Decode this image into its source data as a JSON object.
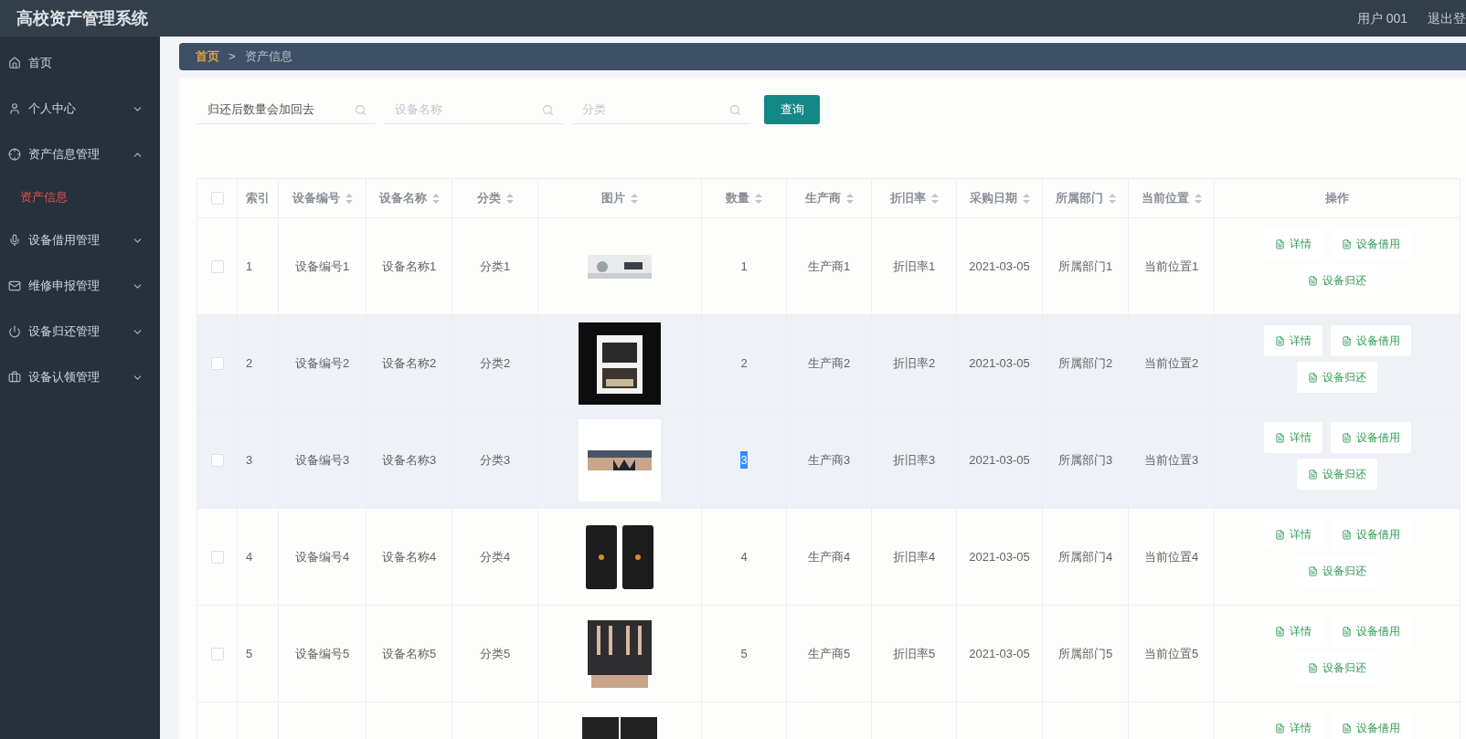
{
  "header": {
    "title": "高校资产管理系统",
    "user": "用户 001",
    "logout": "退出登"
  },
  "sidebar": {
    "items": [
      {
        "label": "首页"
      },
      {
        "label": "个人中心",
        "expanded": false
      },
      {
        "label": "资产信息管理",
        "expanded": true,
        "children": [
          {
            "label": "资产信息",
            "selected": true
          }
        ]
      },
      {
        "label": "设备借用管理",
        "expanded": false
      },
      {
        "label": "维修申报管理",
        "expanded": false
      },
      {
        "label": "设备归还管理",
        "expanded": false
      },
      {
        "label": "设备认领管理",
        "expanded": false
      }
    ]
  },
  "breadcrumb": [
    {
      "label": "首页",
      "selected": true
    },
    {
      "label": "资产信息",
      "selected": false
    }
  ],
  "separator": ">",
  "search": {
    "fields": [
      {
        "value": "归还后数量会加回去"
      },
      {
        "placeholder": "设备名称"
      },
      {
        "placeholder": "分类"
      }
    ],
    "button": "查询"
  },
  "table": {
    "all_checked": false,
    "columns": [
      {
        "label": "索引",
        "sortable": false
      },
      {
        "label": "设备编号",
        "sortable": true
      },
      {
        "label": "设备名称",
        "sortable": true
      },
      {
        "label": "分类",
        "sortable": true
      },
      {
        "label": "图片",
        "sortable": true
      },
      {
        "label": "数量",
        "sortable": true
      },
      {
        "label": "生产商",
        "sortable": true
      },
      {
        "label": "折旧率",
        "sortable": true
      },
      {
        "label": "采购日期",
        "sortable": true
      },
      {
        "label": "所属部门",
        "sortable": true
      },
      {
        "label": "当前位置",
        "sortable": true
      },
      {
        "label": "操作",
        "sortable": false
      }
    ],
    "rows": [
      {
        "checked": false,
        "highlighted": false,
        "quantity_selected": false,
        "cells": [
          "1",
          "设备编号1",
          "设备名称1",
          "分类1",
          "1",
          "生产商1",
          "折旧率1",
          "2021-03-05",
          "所属部门1",
          "当前位置1"
        ],
        "actions": [
          "详情",
          "设备借用",
          "设备归还"
        ]
      },
      {
        "checked": false,
        "highlighted": true,
        "quantity_selected": false,
        "cells": [
          "2",
          "设备编号2",
          "设备名称2",
          "分类2",
          "2",
          "生产商2",
          "折旧率2",
          "2021-03-05",
          "所属部门2",
          "当前位置2"
        ],
        "actions": [
          "详情",
          "设备借用",
          "设备归还"
        ]
      },
      {
        "checked": false,
        "highlighted": true,
        "quantity_selected": true,
        "cells": [
          "3",
          "设备编号3",
          "设备名称3",
          "分类3",
          "3",
          "生产商3",
          "折旧率3",
          "2021-03-05",
          "所属部门3",
          "当前位置3"
        ],
        "actions": [
          "详情",
          "设备借用",
          "设备归还"
        ]
      },
      {
        "checked": false,
        "highlighted": false,
        "quantity_selected": false,
        "cells": [
          "4",
          "设备编号4",
          "设备名称4",
          "分类4",
          "4",
          "生产商4",
          "折旧率4",
          "2021-03-05",
          "所属部门4",
          "当前位置4"
        ],
        "actions": [
          "详情",
          "设备借用",
          "设备归还"
        ]
      },
      {
        "checked": false,
        "highlighted": false,
        "quantity_selected": false,
        "cells": [
          "5",
          "设备编号5",
          "设备名称5",
          "分类5",
          "5",
          "生产商5",
          "折旧率5",
          "2021-03-05",
          "所属部门5",
          "当前位置5"
        ],
        "actions": [
          "详情",
          "设备借用",
          "设备归还"
        ]
      },
      {
        "highlighted": false,
        "actions": [
          "详情",
          "设备借用"
        ]
      }
    ]
  }
}
